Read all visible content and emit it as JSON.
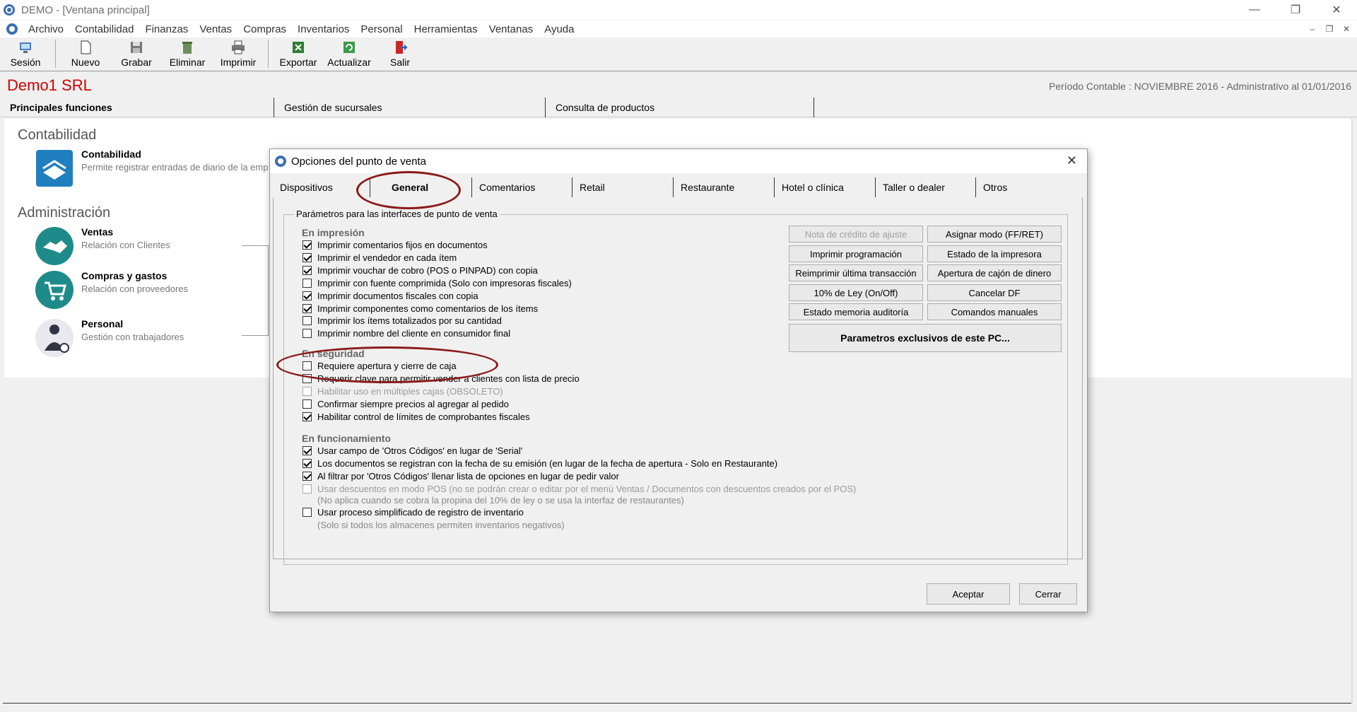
{
  "window": {
    "title": "DEMO - [Ventana principal]",
    "controls": {
      "minimize": "—",
      "restore": "❐",
      "close": "✕"
    }
  },
  "menu": {
    "items": [
      "Archivo",
      "Contabilidad",
      "Finanzas",
      "Ventas",
      "Compras",
      "Inventarios",
      "Personal",
      "Herramientas",
      "Ventanas",
      "Ayuda"
    ],
    "mdi": {
      "minimize": "–",
      "restore": "❐",
      "close": "✕"
    }
  },
  "toolbar": {
    "session": "Sesión",
    "new": "Nuevo",
    "save": "Grabar",
    "delete": "Eliminar",
    "print": "Imprimir",
    "export": "Exportar",
    "refresh": "Actualizar",
    "exit": "Salir"
  },
  "header": {
    "company": "Demo1 SRL",
    "period": "Período Contable : NOVIEMBRE 2016   -   Administrativo al 01/01/2016"
  },
  "main_tabs": [
    "Principales funciones",
    "Gestión de sucursales",
    "Consulta de productos"
  ],
  "panel": {
    "contabilidad_title": "Contabilidad",
    "admin_title": "Administración",
    "functions": [
      {
        "name": "Contabilidad",
        "desc": "Permite registrar entradas de diario de la emp"
      },
      {
        "name": "Ventas",
        "desc": "Relación con Clientes"
      },
      {
        "name": "Compras y gastos",
        "desc": "Relación con proveedores"
      },
      {
        "name": "Personal",
        "desc": "Gestión con trabajadores"
      }
    ]
  },
  "dialog": {
    "title": "Opciones del punto de venta",
    "close": "✕",
    "tabs": [
      "Dispositivos",
      "General",
      "Comentarios",
      "Retail",
      "Restaurante",
      "Hotel o clínica",
      "Taller o dealer",
      "Otros"
    ],
    "group_title": "Parámetros para las interfaces de punto de venta",
    "impresion": {
      "heading": "En impresión",
      "items": [
        {
          "label": "Imprimir comentarios fijos en documentos",
          "checked": true
        },
        {
          "label": "Imprimir el vendedor en cada ítem",
          "checked": true
        },
        {
          "label": "Imprimir vouchar de cobro (POS  o PINPAD) con copia",
          "checked": true
        },
        {
          "label": "Imprimir con fuente comprimida (Solo con impresoras fiscales)",
          "checked": false
        },
        {
          "label": "Imprimir documentos fiscales con copia",
          "checked": true
        },
        {
          "label": "Imprimir componentes como comentarios de los ítems",
          "checked": true
        },
        {
          "label": "Imprimir los ítems totalizados por su cantidad",
          "checked": false
        },
        {
          "label": "Imprimir nombre del cliente en consumidor final",
          "checked": false
        }
      ]
    },
    "seguridad": {
      "heading": "En seguridad",
      "items": [
        {
          "label": "Requiere apertura y cierre de caja",
          "checked": false,
          "disabled": false
        },
        {
          "label": "Requerir clave para permitir vender a clientes con lista de precio",
          "checked": false,
          "disabled": false
        },
        {
          "label": "Habilitar uso en múltiples cajas (OBSOLETO)",
          "checked": false,
          "disabled": true
        },
        {
          "label": "Confirmar siempre precios al agregar al pedido",
          "checked": false,
          "disabled": false
        },
        {
          "label": "Habilitar control de límites de comprobantes fiscales",
          "checked": true,
          "disabled": false
        }
      ]
    },
    "funcionamiento": {
      "heading": "En funcionamiento",
      "items": [
        {
          "label": "Usar campo de 'Otros Códigos' en lugar de 'Serial'",
          "checked": true,
          "disabled": false
        },
        {
          "label": "Los documentos se registran con la fecha de su emisión (en lugar de la fecha de apertura - Solo en Restaurante)",
          "checked": true,
          "disabled": false
        },
        {
          "label": "Al filtrar por 'Otros Códigos' llenar lista de opciones en lugar de pedir valor",
          "checked": true,
          "disabled": false
        },
        {
          "label": "Usar descuentos en modo POS (no se podrán crear o editar por el menú Ventas / Documentos con descuentos creados por el POS)",
          "checked": false,
          "disabled": true
        },
        {
          "label": "Usar proceso simplificado de registro de inventario",
          "checked": false,
          "disabled": false
        }
      ],
      "note_descuentos": "(No aplica cuando se cobra la propina del 10% de ley o se usa la interfaz de restaurantes)",
      "note_inventario": "(Solo si todos los almacenes permiten inventarios negativos)"
    },
    "buttons": {
      "nota_credito": "Nota de crédito de ajuste",
      "asignar_modo": "Asignar modo (FF/RET)",
      "imprimir_programacion": "Imprimir programación",
      "estado_impresora": "Estado de la impresora",
      "reimprimir": "Reimprimir última transacción",
      "apertura_cajon": "Apertura de cajón de dinero",
      "ley10": "10% de Ley (On/Off)",
      "cancelar_df": "Cancelar DF",
      "memoria_auditoria": "Estado memoria auditoría",
      "comandos_manuales": "Comandos manuales",
      "parametros_pc": "Parametros exclusivos de este PC...",
      "aceptar": "Aceptar",
      "cerrar": "Cerrar"
    }
  },
  "colors": {
    "company": "#d40000",
    "annotation_ring": "#8b1a1a",
    "teal_icon": "#1f8a8a"
  }
}
